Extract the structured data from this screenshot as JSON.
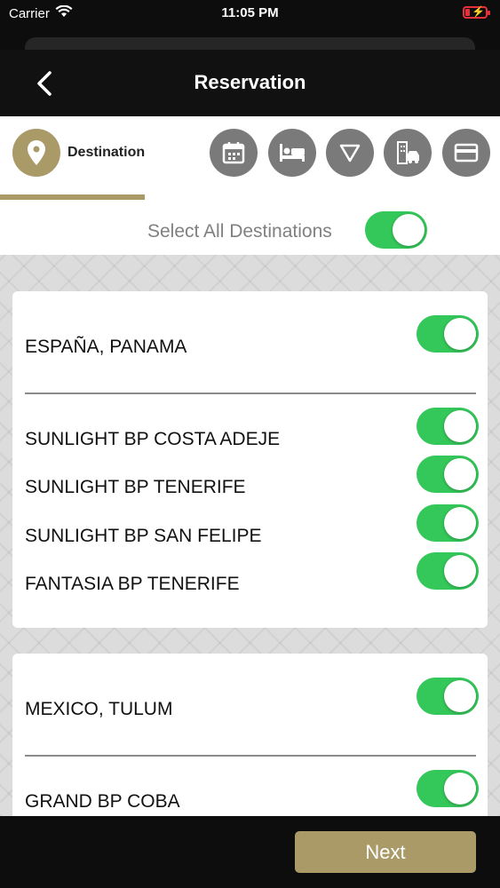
{
  "status_bar": {
    "carrier": "Carrier",
    "time": "11:05 PM",
    "battery_color": "#e8303a"
  },
  "nav": {
    "title": "Reservation"
  },
  "steps": {
    "active_label": "Destination",
    "items": [
      "destination-pin-icon",
      "calendar-icon",
      "bed-icon",
      "triangle-down-icon",
      "city-car-icon",
      "credit-card-icon"
    ]
  },
  "select_all": {
    "label": "Select All Destinations",
    "on": true
  },
  "groups": [
    {
      "header": "ESPAÑA, PANAMA",
      "items": [
        "SUNLIGHT BP COSTA ADEJE",
        "SUNLIGHT BP TENERIFE",
        "SUNLIGHT BP SAN FELIPE",
        "FANTASIA BP TENERIFE"
      ]
    },
    {
      "header": "MEXICO, TULUM",
      "items": [
        "GRAND BP COBA"
      ]
    }
  ],
  "footer": {
    "next_label": "Next"
  },
  "colors": {
    "accent": "#a99a68",
    "toggle_on": "#34c759",
    "inactive_step": "#7a7a7a"
  }
}
